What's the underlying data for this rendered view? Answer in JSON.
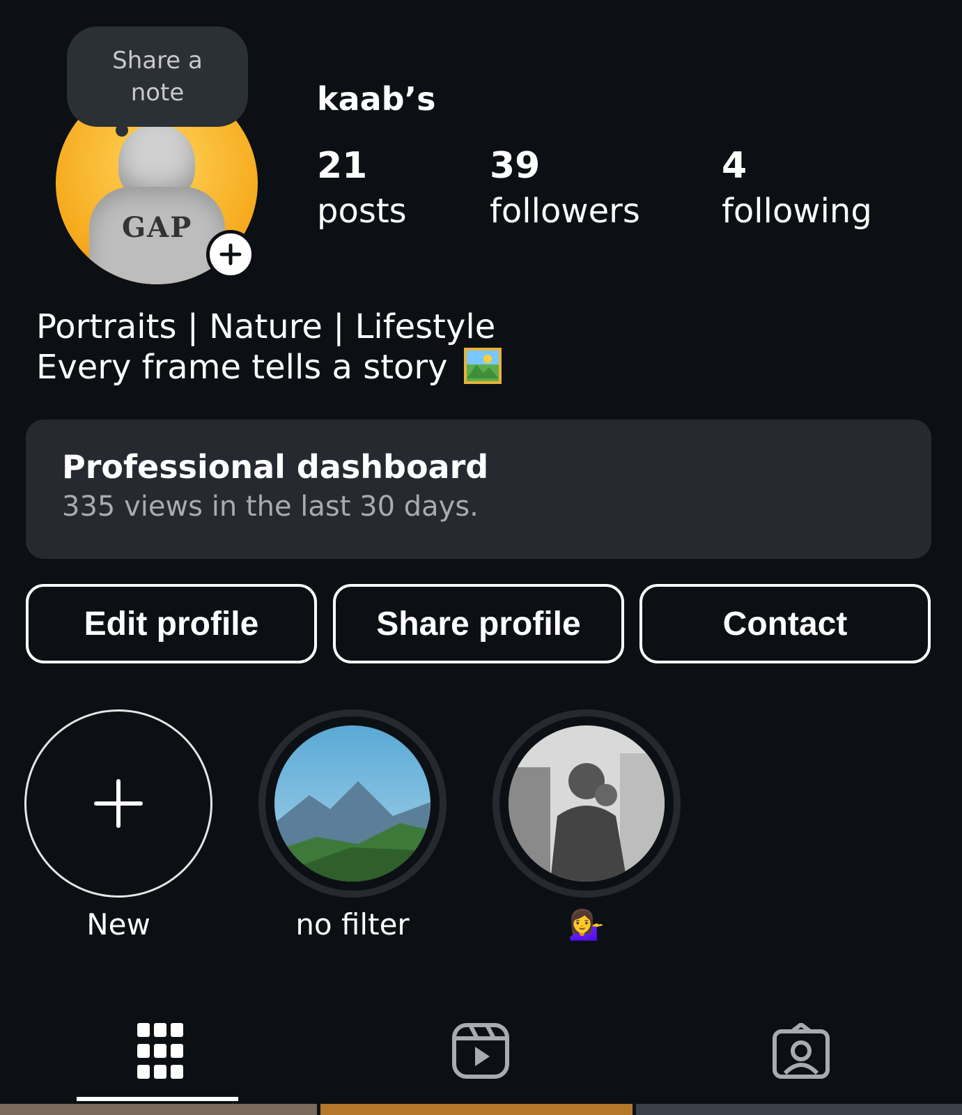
{
  "profile": {
    "note_prompt": "Share a note",
    "username": "kaab’s",
    "stats": [
      {
        "value": "21",
        "label": "posts"
      },
      {
        "value": "39",
        "label": "followers"
      },
      {
        "value": "4",
        "label": "following"
      }
    ],
    "avatar_text": "GAP",
    "bio_line1": "Portraits | Nature | Lifestyle",
    "bio_line2": "Every frame tells a story"
  },
  "dashboard": {
    "title": "Professional dashboard",
    "subtitle": "335 views in the last 30 days."
  },
  "actions": {
    "edit": "Edit profile",
    "share": "Share profile",
    "contact": "Contact"
  },
  "highlights": [
    {
      "label": "New"
    },
    {
      "label": "no filter"
    },
    {
      "label": "💁‍♀️"
    }
  ],
  "tabs": [
    {
      "icon": "grid-icon",
      "active": true
    },
    {
      "icon": "reels-icon",
      "active": false
    },
    {
      "icon": "tagged-icon",
      "active": false
    }
  ],
  "colors": {
    "background": "#0c1014",
    "card": "#262a30",
    "muted_text": "#a8acb2"
  }
}
